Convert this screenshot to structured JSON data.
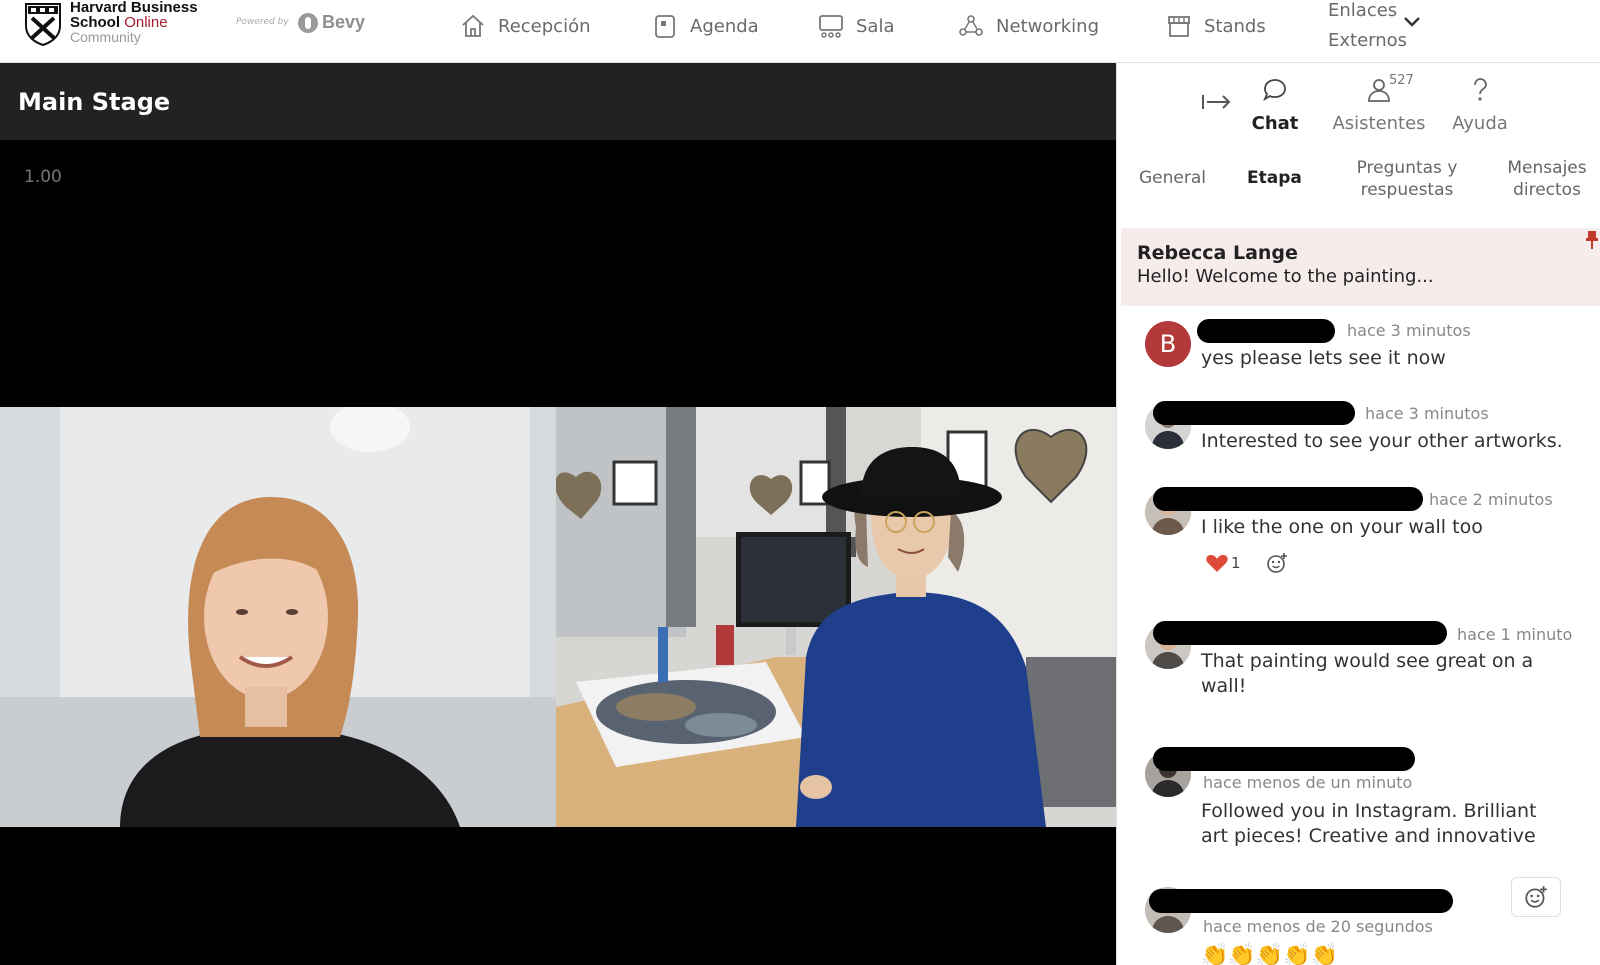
{
  "header": {
    "brand_line1": "Harvard Business",
    "brand_school": "School",
    "brand_online": "Online",
    "brand_line3": "Community",
    "powered_by": "Powered by",
    "partner": "Bevy",
    "nav": [
      {
        "label": "Recepción",
        "icon": "home-icon"
      },
      {
        "label": "Agenda",
        "icon": "agenda-icon"
      },
      {
        "label": "Sala",
        "icon": "sala-icon"
      },
      {
        "label": "Networking",
        "icon": "networking-icon"
      },
      {
        "label": "Stands",
        "icon": "stands-icon"
      }
    ],
    "external_links_line1": "Enlaces",
    "external_links_line2": "Externos"
  },
  "stage": {
    "title": "Main Stage",
    "playback_speed": "1.00"
  },
  "panel": {
    "tabs": [
      {
        "label": "Chat",
        "active": true
      },
      {
        "label": "Asistentes",
        "count": "527"
      },
      {
        "label": "Ayuda"
      }
    ],
    "subtabs": [
      {
        "label": "General"
      },
      {
        "label": "Etapa",
        "active": true
      },
      {
        "label_line1": "Preguntas y",
        "label_line2": "respuestas"
      },
      {
        "label_line1": "Mensajes",
        "label_line2": "directos"
      }
    ],
    "pinned": {
      "author": "Rebecca Lange",
      "text": "Hello! Welcome to the painting..."
    },
    "messages": [
      {
        "avatar_letter": "B",
        "time": "hace 3 minutos",
        "text": "yes please lets see it now"
      },
      {
        "time": "hace 3 minutos",
        "text": "Interested to see your other artworks."
      },
      {
        "time": "hace 2 minutos",
        "text": "I like the one on your wall too",
        "reaction_count": "1"
      },
      {
        "time": "hace 1 minuto",
        "text_line1": "That painting would see great on a",
        "text_line2": "wall!"
      },
      {
        "time": "hace menos de un minuto",
        "text_line1": "Followed you in Instagram. Brilliant",
        "text_line2": "art pieces! Creative and innovative"
      },
      {
        "time": "hace menos de 20 segundos",
        "emoji": "👏"
      }
    ]
  },
  "colors": {
    "accent_red": "#a51c30",
    "pinned_bg": "#f7ecec",
    "avatar_b": "#b23a3a",
    "stage_header": "#222222"
  }
}
